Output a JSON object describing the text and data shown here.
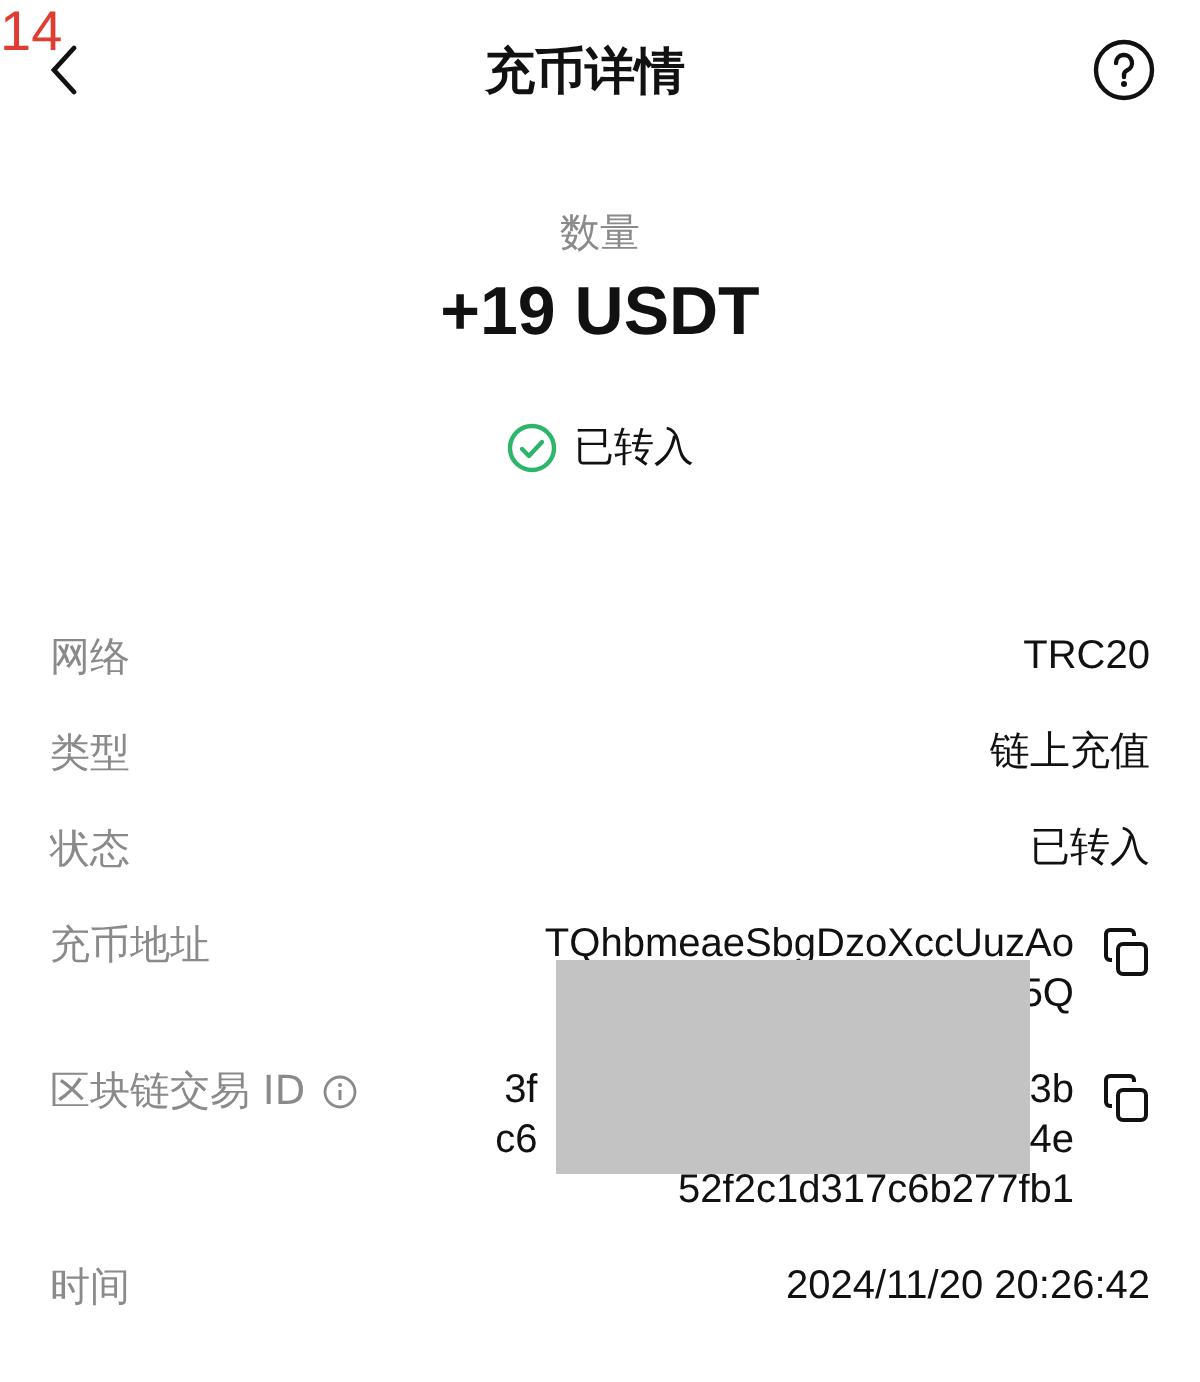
{
  "page_marker": "14",
  "header": {
    "title": "充币详情"
  },
  "amount": {
    "label": "数量",
    "value": "+19 USDT"
  },
  "status": {
    "text": "已转入",
    "done": true
  },
  "details": [
    {
      "label": "网络",
      "lines": [
        {
          "parts": [
            "TRC20"
          ]
        }
      ],
      "copyable": false,
      "info": false
    },
    {
      "label": "类型",
      "lines": [
        {
          "parts": [
            "链上充值"
          ]
        }
      ],
      "copyable": false,
      "info": false
    },
    {
      "label": "状态",
      "lines": [
        {
          "parts": [
            "已转入"
          ]
        }
      ],
      "copyable": false,
      "info": false
    },
    {
      "label": "充币地址",
      "lines": [
        {
          "parts": [
            "TQhbmeaeSbgDzoXccUuzAo"
          ]
        },
        {
          "parts": [
            "5Q"
          ]
        }
      ],
      "copyable": true,
      "info": false
    },
    {
      "label": "区块链交易 ID",
      "lines": [
        {
          "parts": [
            "3f",
            "3b"
          ]
        },
        {
          "parts": [
            "c6",
            "4e"
          ]
        },
        {
          "parts": [
            "52f2c1d317c6b277fb1"
          ]
        }
      ],
      "copyable": true,
      "info": true
    },
    {
      "label": "时间",
      "lines": [
        {
          "parts": [
            "2024/11/20 20:26:42"
          ]
        }
      ],
      "copyable": false,
      "info": false
    }
  ]
}
